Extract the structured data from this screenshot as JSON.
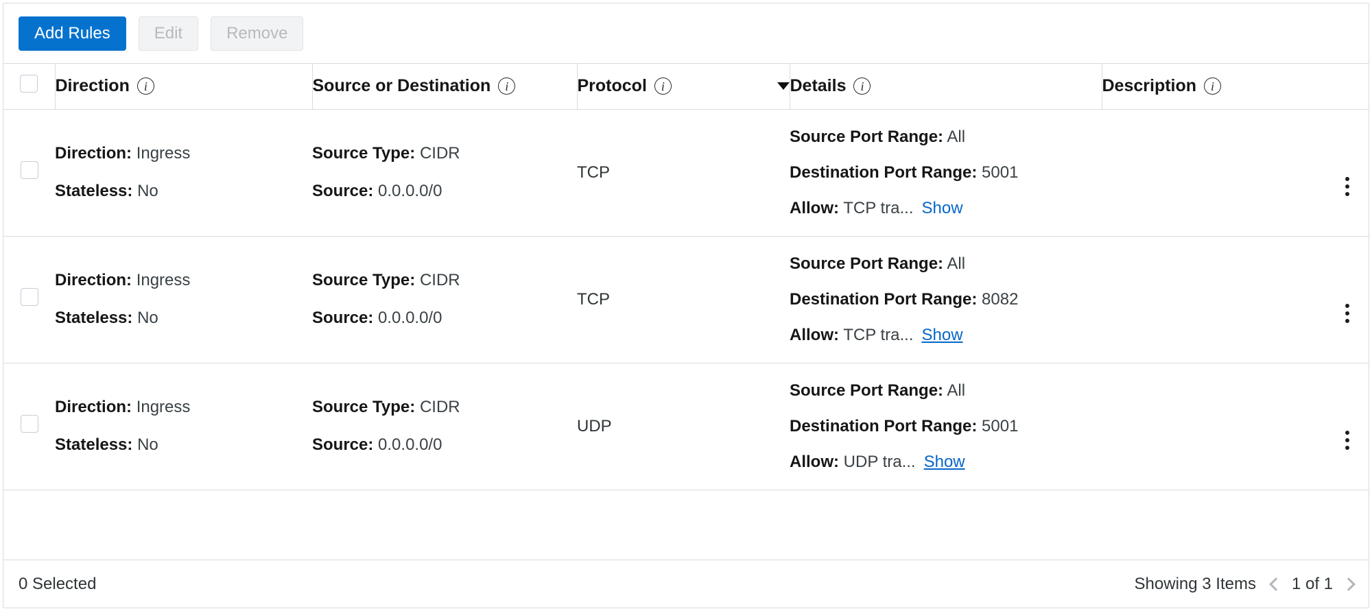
{
  "toolbar": {
    "add_rules_label": "Add Rules",
    "edit_label": "Edit",
    "remove_label": "Remove"
  },
  "colors": {
    "primary": "#0572ce",
    "link": "#0666c9",
    "border": "#d6dbe0",
    "text": "#2f3437",
    "disabled_text": "#b6babd"
  },
  "table": {
    "columns": [
      {
        "label": "Direction",
        "has_info": true,
        "has_sort_caret": false
      },
      {
        "label": "Source or Destination",
        "has_info": true,
        "has_sort_caret": false
      },
      {
        "label": "Protocol",
        "has_info": true,
        "has_sort_caret": true
      },
      {
        "label": "Details",
        "has_info": true,
        "has_sort_caret": false
      },
      {
        "label": "Description",
        "has_info": true,
        "has_sort_caret": false
      }
    ],
    "rows": [
      {
        "direction_label": "Direction:",
        "direction_value": "Ingress",
        "stateless_label": "Stateless:",
        "stateless_value": "No",
        "source_type_label": "Source Type:",
        "source_type_value": "CIDR",
        "source_label": "Source:",
        "source_value": "0.0.0.0/0",
        "protocol": "TCP",
        "source_port_label": "Source Port Range:",
        "source_port_value": "All",
        "dest_port_label": "Destination Port Range:",
        "dest_port_value": "5001",
        "allow_label": "Allow:",
        "allow_value": "TCP tra...",
        "show_label": "Show",
        "show_underlined": false,
        "description": ""
      },
      {
        "direction_label": "Direction:",
        "direction_value": "Ingress",
        "stateless_label": "Stateless:",
        "stateless_value": "No",
        "source_type_label": "Source Type:",
        "source_type_value": "CIDR",
        "source_label": "Source:",
        "source_value": "0.0.0.0/0",
        "protocol": "TCP",
        "source_port_label": "Source Port Range:",
        "source_port_value": "All",
        "dest_port_label": "Destination Port Range:",
        "dest_port_value": "8082",
        "allow_label": "Allow:",
        "allow_value": "TCP tra...",
        "show_label": "Show",
        "show_underlined": true,
        "description": ""
      },
      {
        "direction_label": "Direction:",
        "direction_value": "Ingress",
        "stateless_label": "Stateless:",
        "stateless_value": "No",
        "source_type_label": "Source Type:",
        "source_type_value": "CIDR",
        "source_label": "Source:",
        "source_value": "0.0.0.0/0",
        "protocol": "UDP",
        "source_port_label": "Source Port Range:",
        "source_port_value": "All",
        "dest_port_label": "Destination Port Range:",
        "dest_port_value": "5001",
        "allow_label": "Allow:",
        "allow_value": "UDP tra...",
        "show_label": "Show",
        "show_underlined": true,
        "description": ""
      }
    ]
  },
  "footer": {
    "selected_text": "0 Selected",
    "showing_text": "Showing 3 Items",
    "page_text": "1 of 1",
    "prev_icon": "chevron-left-icon",
    "next_icon": "chevron-right-icon"
  },
  "icons": {
    "info": "info-icon",
    "kebab": "kebab-menu-icon",
    "sort_caret": "chevron-down-icon",
    "checkbox": "checkbox-icon"
  }
}
